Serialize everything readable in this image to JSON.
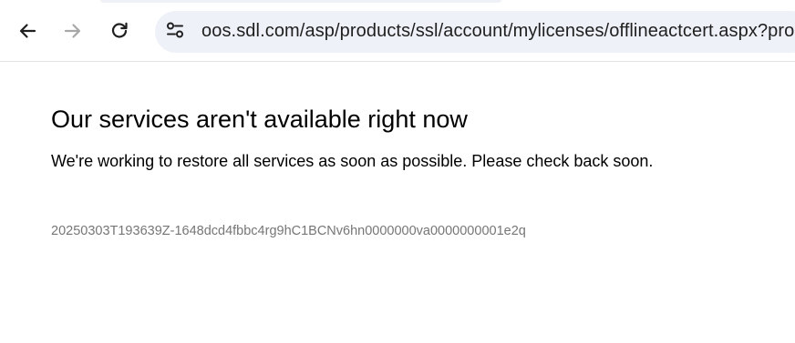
{
  "browser": {
    "address_bar": {
      "url": "oos.sdl.com/asp/products/ssl/account/mylicenses/offlineactcert.aspx?prod"
    },
    "icons": [
      "back-arrow-icon",
      "forward-arrow-icon",
      "reload-icon",
      "site-info-tune-icon"
    ]
  },
  "page": {
    "title": "Our services aren't available right now",
    "message": "We're working to restore all services as soon as possible. Please check back soon.",
    "reference_id": "20250303T193639Z-1648dcd4fbbc4rg9hC1BCNv6hn0000000va0000000001e2q"
  },
  "colors": {
    "omnibox_bg": "#eef1f8",
    "reference_text": "#767676",
    "disabled_icon": "#a8a8a8"
  }
}
